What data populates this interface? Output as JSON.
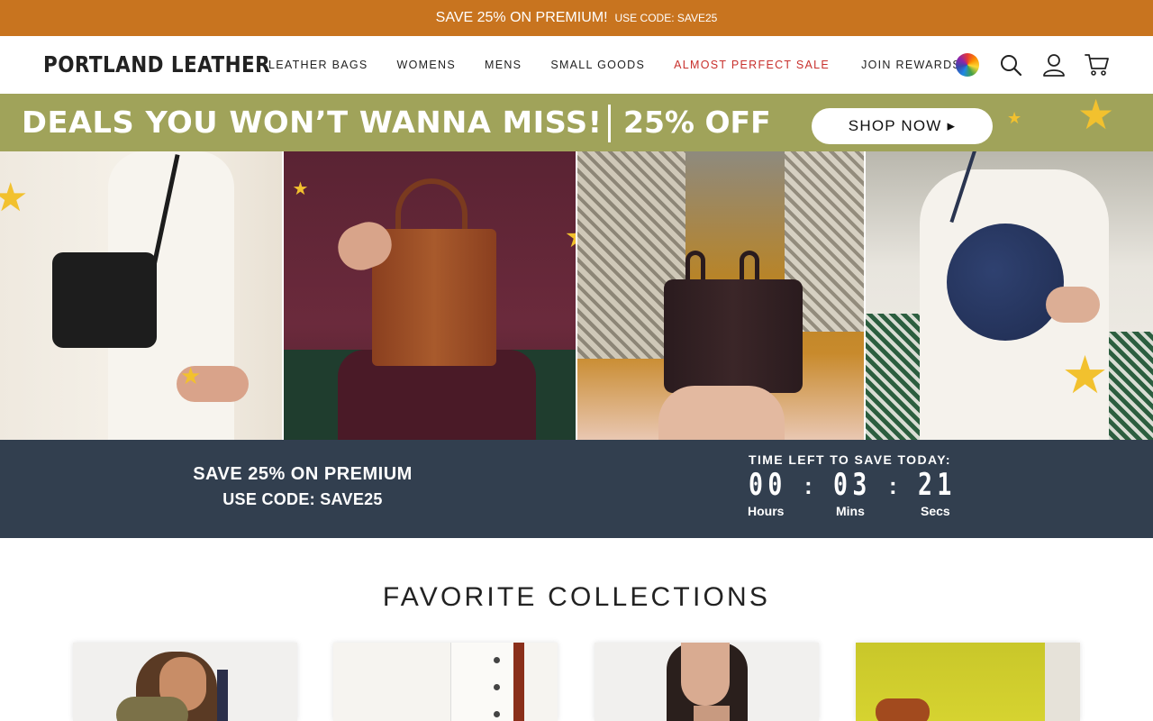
{
  "promo_bar": {
    "headline": "SAVE 25% ON PREMIUM!",
    "code": "USE CODE: SAVE25",
    "color": "#c8741f"
  },
  "header": {
    "logo": "PORTLAND LEATHER",
    "nav": [
      {
        "label": "LEATHER BAGS"
      },
      {
        "label": "WOMENS"
      },
      {
        "label": "MENS"
      },
      {
        "label": "SMALL GOODS"
      },
      {
        "label": "ALMOST PERFECT SALE",
        "color": "#c8302c"
      },
      {
        "label": "JOIN REWARDS"
      }
    ],
    "icons": [
      "color-wheel-icon",
      "search-icon",
      "account-icon",
      "cart-icon"
    ]
  },
  "deals_banner": {
    "headline": "DEALS YOU WON’T WANNA MISS!",
    "discount": "25% OFF",
    "cta": "SHOP NOW ▸",
    "background": "#a0a35a"
  },
  "hero": {
    "panels": [
      "black-crossbody-bag-photo",
      "brown-tote-bag-photo",
      "dark-handbag-photo",
      "navy-round-bag-photo"
    ]
  },
  "countdown": {
    "promo_line1": "SAVE 25% ON PREMIUM",
    "promo_line2": "USE CODE: SAVE25",
    "label": "TIME LEFT TO SAVE TODAY:",
    "hours": "00",
    "minutes": "03",
    "seconds": "21",
    "separator": ":",
    "units": {
      "hours": "Hours",
      "minutes": "Mins",
      "seconds": "Secs"
    },
    "background": "#323f4f"
  },
  "collections": {
    "title": "FAVORITE COLLECTIONS",
    "cards": [
      "collection-card-1",
      "collection-card-2",
      "collection-card-3",
      "collection-card-4"
    ]
  }
}
